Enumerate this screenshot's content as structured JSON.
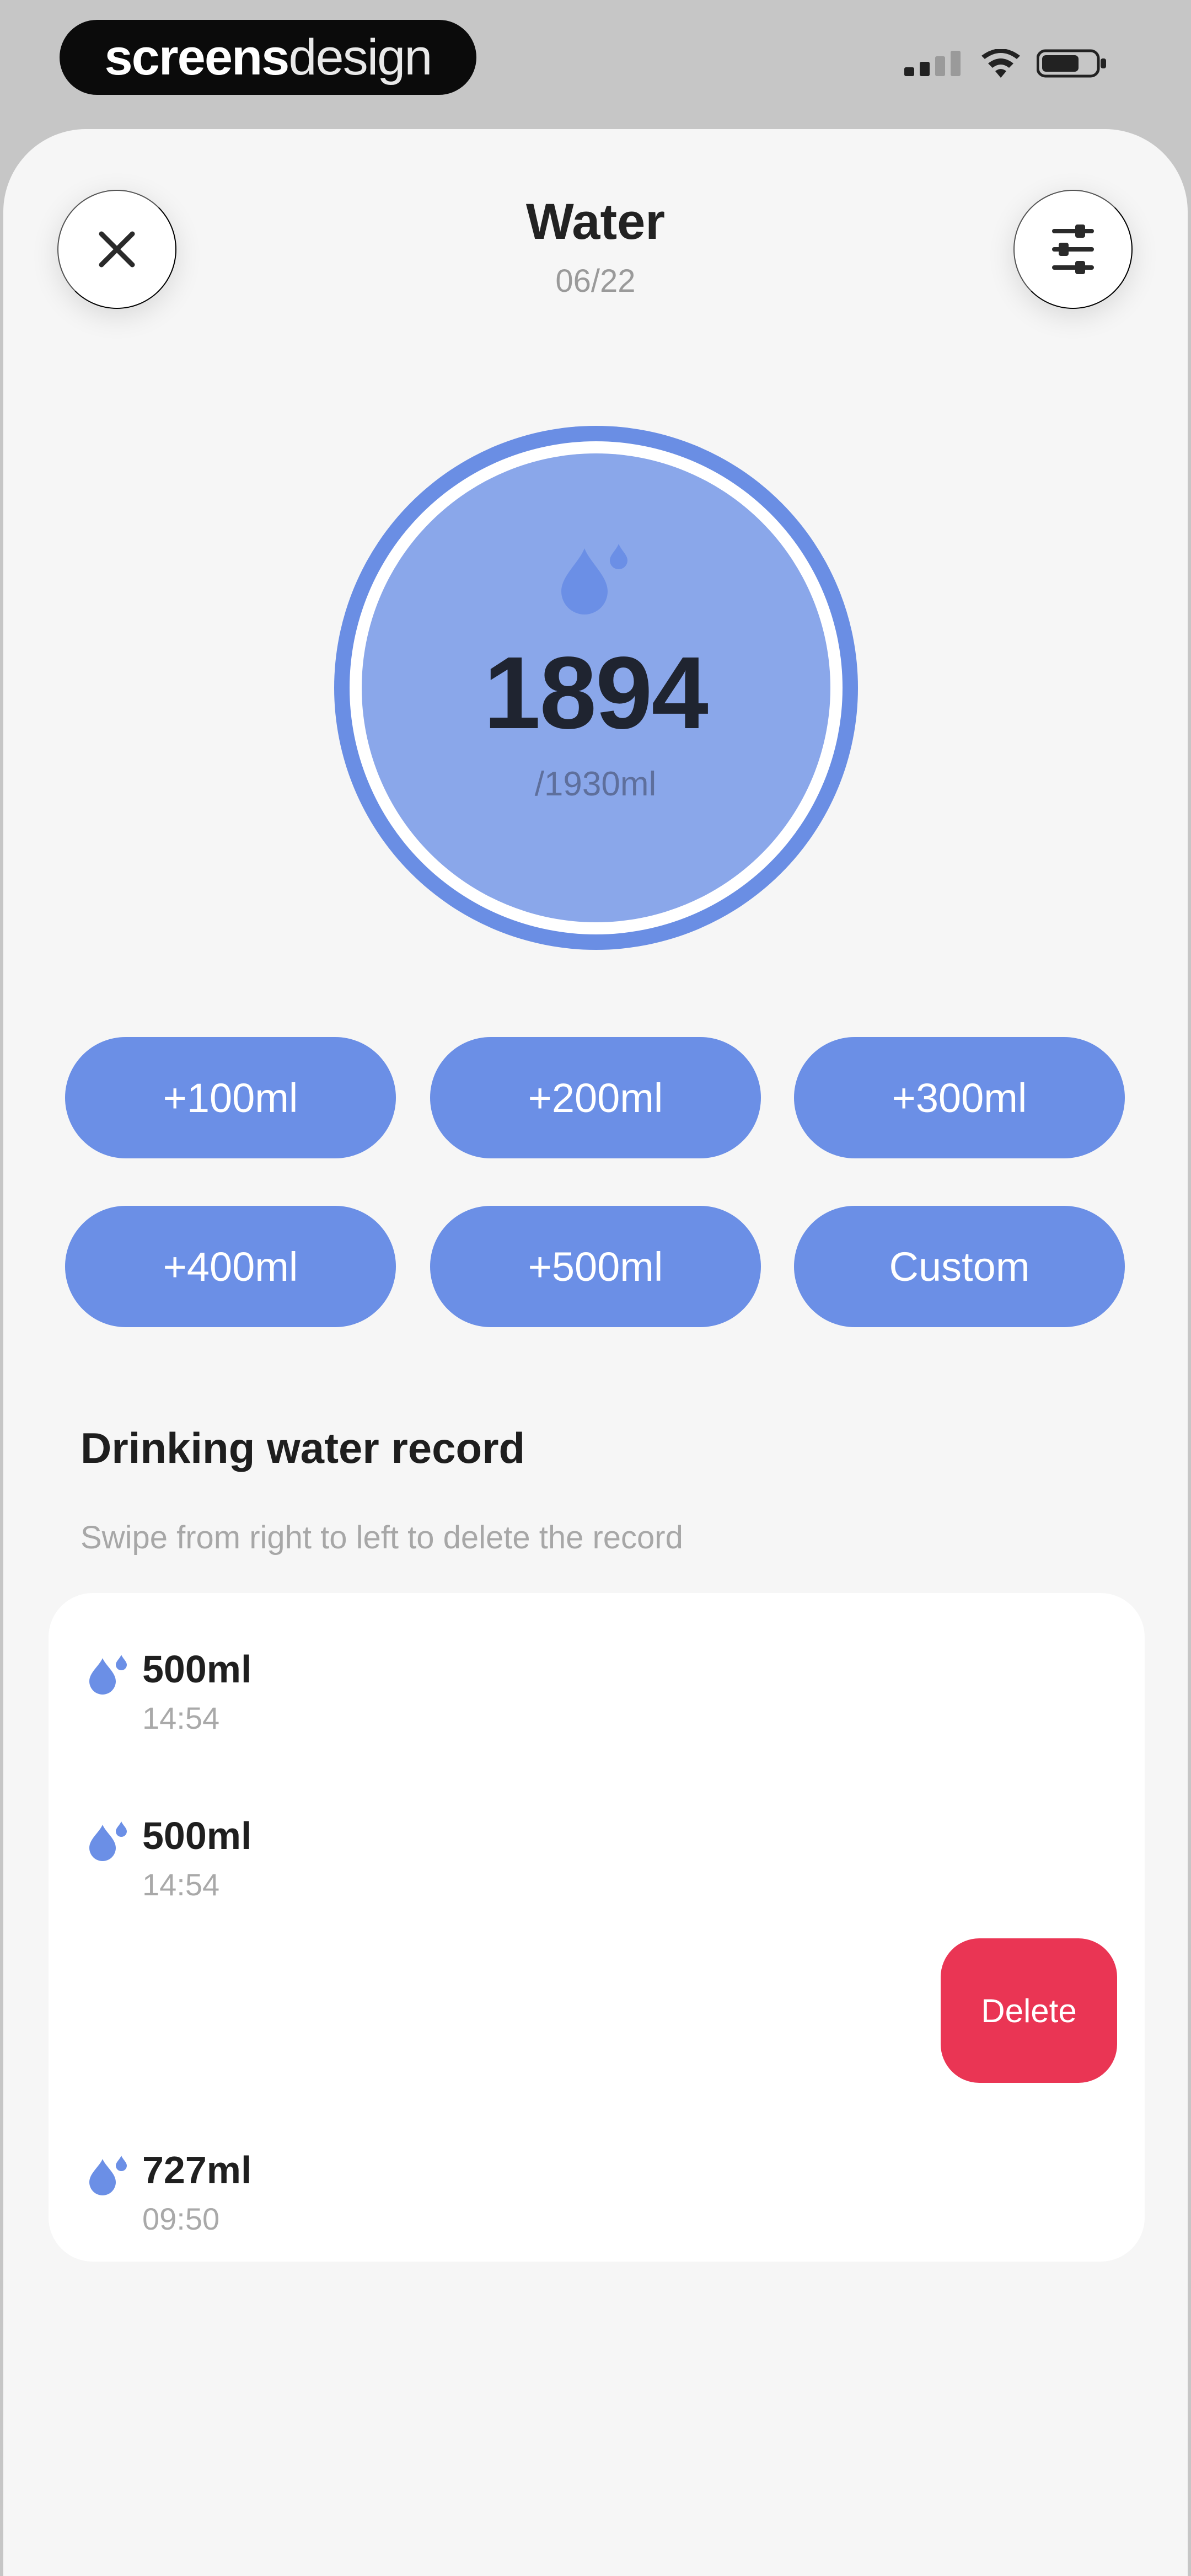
{
  "status_bar": {
    "brand_bold": "screens",
    "brand_light": "design",
    "icons": [
      "signal-icon",
      "wifi-icon",
      "battery-icon"
    ]
  },
  "header": {
    "title": "Water",
    "date": "06/22",
    "close_icon": "close-icon",
    "settings_icon": "sliders-icon"
  },
  "progress": {
    "amount": "1894",
    "goal": "/1930ml",
    "icon": "water-drop-icon"
  },
  "quick_add": [
    "+100ml",
    "+200ml",
    "+300ml",
    "+400ml",
    "+500ml",
    "Custom"
  ],
  "records_section": {
    "title": "Drinking water record",
    "hint": "Swipe from right to left to delete the record"
  },
  "records": [
    {
      "amount": "500ml",
      "time": "14:54"
    },
    {
      "amount": "500ml",
      "time": "14:54"
    },
    {
      "amount": "727ml",
      "time": "09:50"
    }
  ],
  "delete_label": "Delete",
  "colors": {
    "accent": "#6b8fe6",
    "ring_fill": "#8aa7ea",
    "delete": "#ea3554",
    "sheet_bg": "#f6f6f6"
  }
}
